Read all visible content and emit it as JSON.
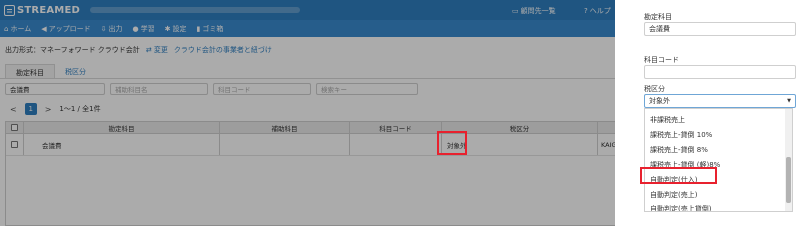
{
  "header": {
    "brand": "STREAMED",
    "client_list": "顧問先一覧",
    "help": "ヘルプ"
  },
  "nav": [
    {
      "icon": "⌂",
      "label": "ホーム"
    },
    {
      "icon": "◀",
      "label": "アップロード"
    },
    {
      "icon": "⇩",
      "label": "出力"
    },
    {
      "icon": "●",
      "label": "学習"
    },
    {
      "icon": "✱",
      "label": "設定"
    },
    {
      "icon": "▮",
      "label": "ゴミ箱"
    }
  ],
  "format_line": {
    "label": "出力形式：マネーフォワード クラウド会計",
    "change": "⇄ 変更",
    "link": "クラウド会計の事業者と紐づけ"
  },
  "tabs": {
    "account": "勘定科目",
    "tax": "税区分"
  },
  "filters": {
    "account_value": "会議費",
    "sub_placeholder": "補助科目名",
    "code_placeholder": "科目コード",
    "keyword_placeholder": "検索キー"
  },
  "pager": {
    "prev": "<",
    "current": "1",
    "next": ">",
    "summary": "1〜1 / 全1件"
  },
  "table": {
    "headers": [
      "勘定科目",
      "補助科目",
      "科目コード",
      "税区分"
    ],
    "rows": [
      {
        "account": "会議費",
        "sub": "",
        "code": "",
        "tax": "対象外",
        "extra": "KAIGI"
      }
    ]
  },
  "panel": {
    "account_label": "勘定科目",
    "account_value": "会議費",
    "code_label": "科目コード",
    "code_value": "",
    "tax_label": "税区分",
    "tax_value": "対象外",
    "options": [
      "非課税売上",
      "課税売上-貸倒 10%",
      "課税売上-貸倒 8%",
      "課税売上-貸倒 (軽)8%",
      "自動判定(仕入)",
      "自動判定(売上)",
      "自動判定(売上貸倒)"
    ],
    "highlighted_option": "自動判定(仕入)"
  },
  "colors": {
    "brand_blue": "#2f7fc1",
    "highlight_red": "#e8212e"
  }
}
